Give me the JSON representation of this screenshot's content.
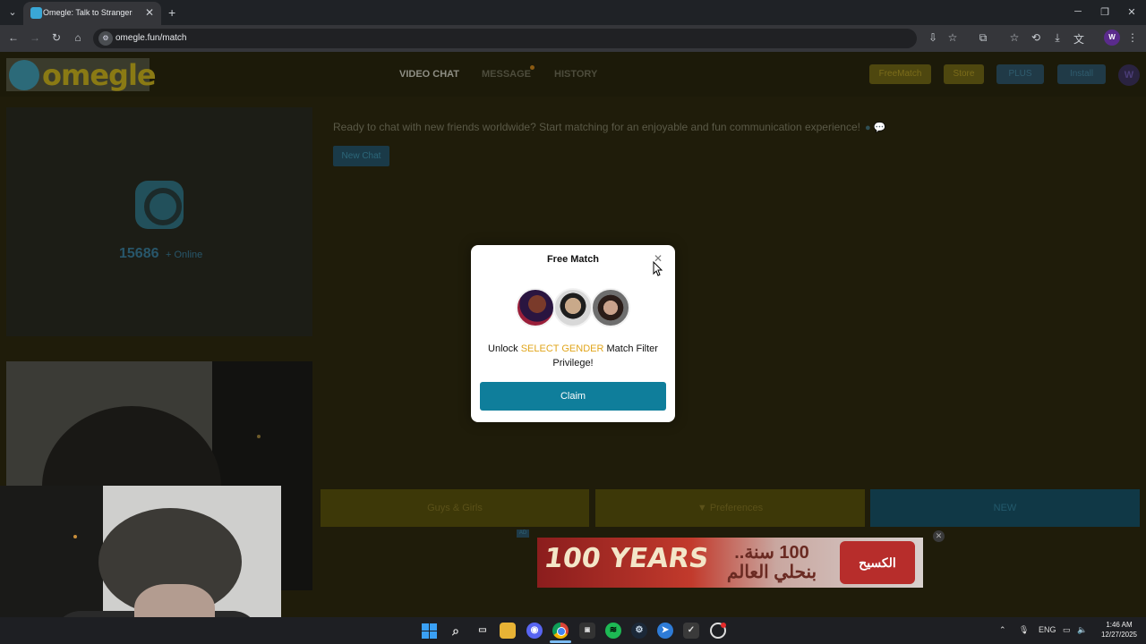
{
  "browser": {
    "tab_title": "Omegle: Talk to Strangers",
    "url": "omegle.fun/match",
    "profile_initial": "W"
  },
  "nav": {
    "logo_text": "omegle",
    "links": [
      "VIDEO CHAT",
      "MESSAGE",
      "HISTORY"
    ],
    "buttons": {
      "freematch": "FreeMatch",
      "store": "Store",
      "plus": "PLUS",
      "install": "Install",
      "avatar": "W"
    }
  },
  "left_panel": {
    "online_count": "15686",
    "online_label": "+ Online"
  },
  "chat": {
    "welcome": "Ready to chat with new friends worldwide? Start matching for an enjoyable and fun communication experience!",
    "new_chat_label": "New Chat"
  },
  "bottom_bar": {
    "guys_girls": "Guys & Girls",
    "preferences": "Preferences",
    "new": "NEW"
  },
  "ad": {
    "label": "AD",
    "years_text": "100 YEARS",
    "arabic_text": "100 سنة.. بنحلي العالم",
    "brand_text": "الكسيح"
  },
  "modal": {
    "title": "Free Match",
    "text_before": "Unlock ",
    "highlight": "SELECT GENDER",
    "text_after": " Match Filter Privilege!",
    "claim_label": "Claim",
    "highlight_color": "#e1a51b",
    "button_color": "#0f7e9b"
  },
  "taskbar": {
    "language": "ENG",
    "time": "1:46 AM",
    "date": "12/27/2025"
  }
}
